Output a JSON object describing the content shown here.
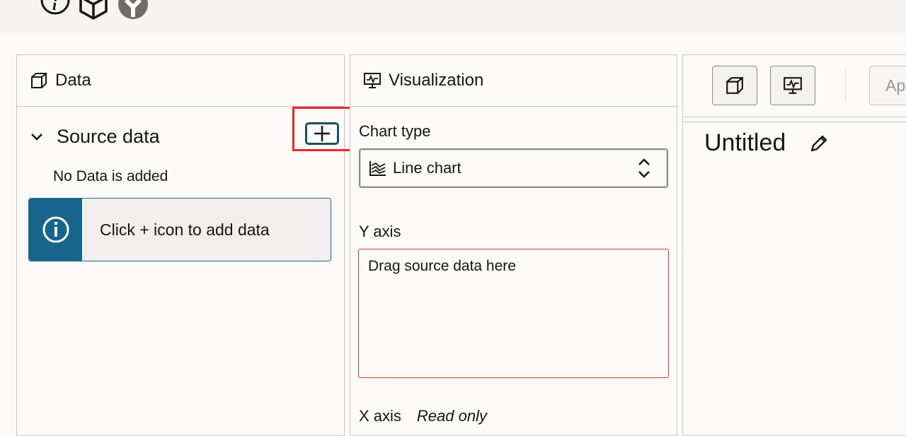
{
  "topbar": {
    "icons": [
      "info-icon",
      "cube-icon",
      "app-logo-icon"
    ]
  },
  "data_panel": {
    "title": "Data",
    "section_title": "Source data",
    "empty_text": "No Data is added",
    "info_banner": "Click + icon to add data"
  },
  "viz_panel": {
    "title": "Visualization",
    "chart_type_label": "Chart type",
    "chart_type_value": "Line chart",
    "y_axis_label": "Y axis",
    "y_axis_placeholder": "Drag source data here",
    "x_axis_label": "X axis",
    "x_axis_note": "Read only"
  },
  "preview_panel": {
    "apply_label": "Ap",
    "chart_title": "Untitled"
  },
  "colors": {
    "accent": "#17668a",
    "highlight": "#e8262b",
    "error_border": "#d9332f"
  }
}
